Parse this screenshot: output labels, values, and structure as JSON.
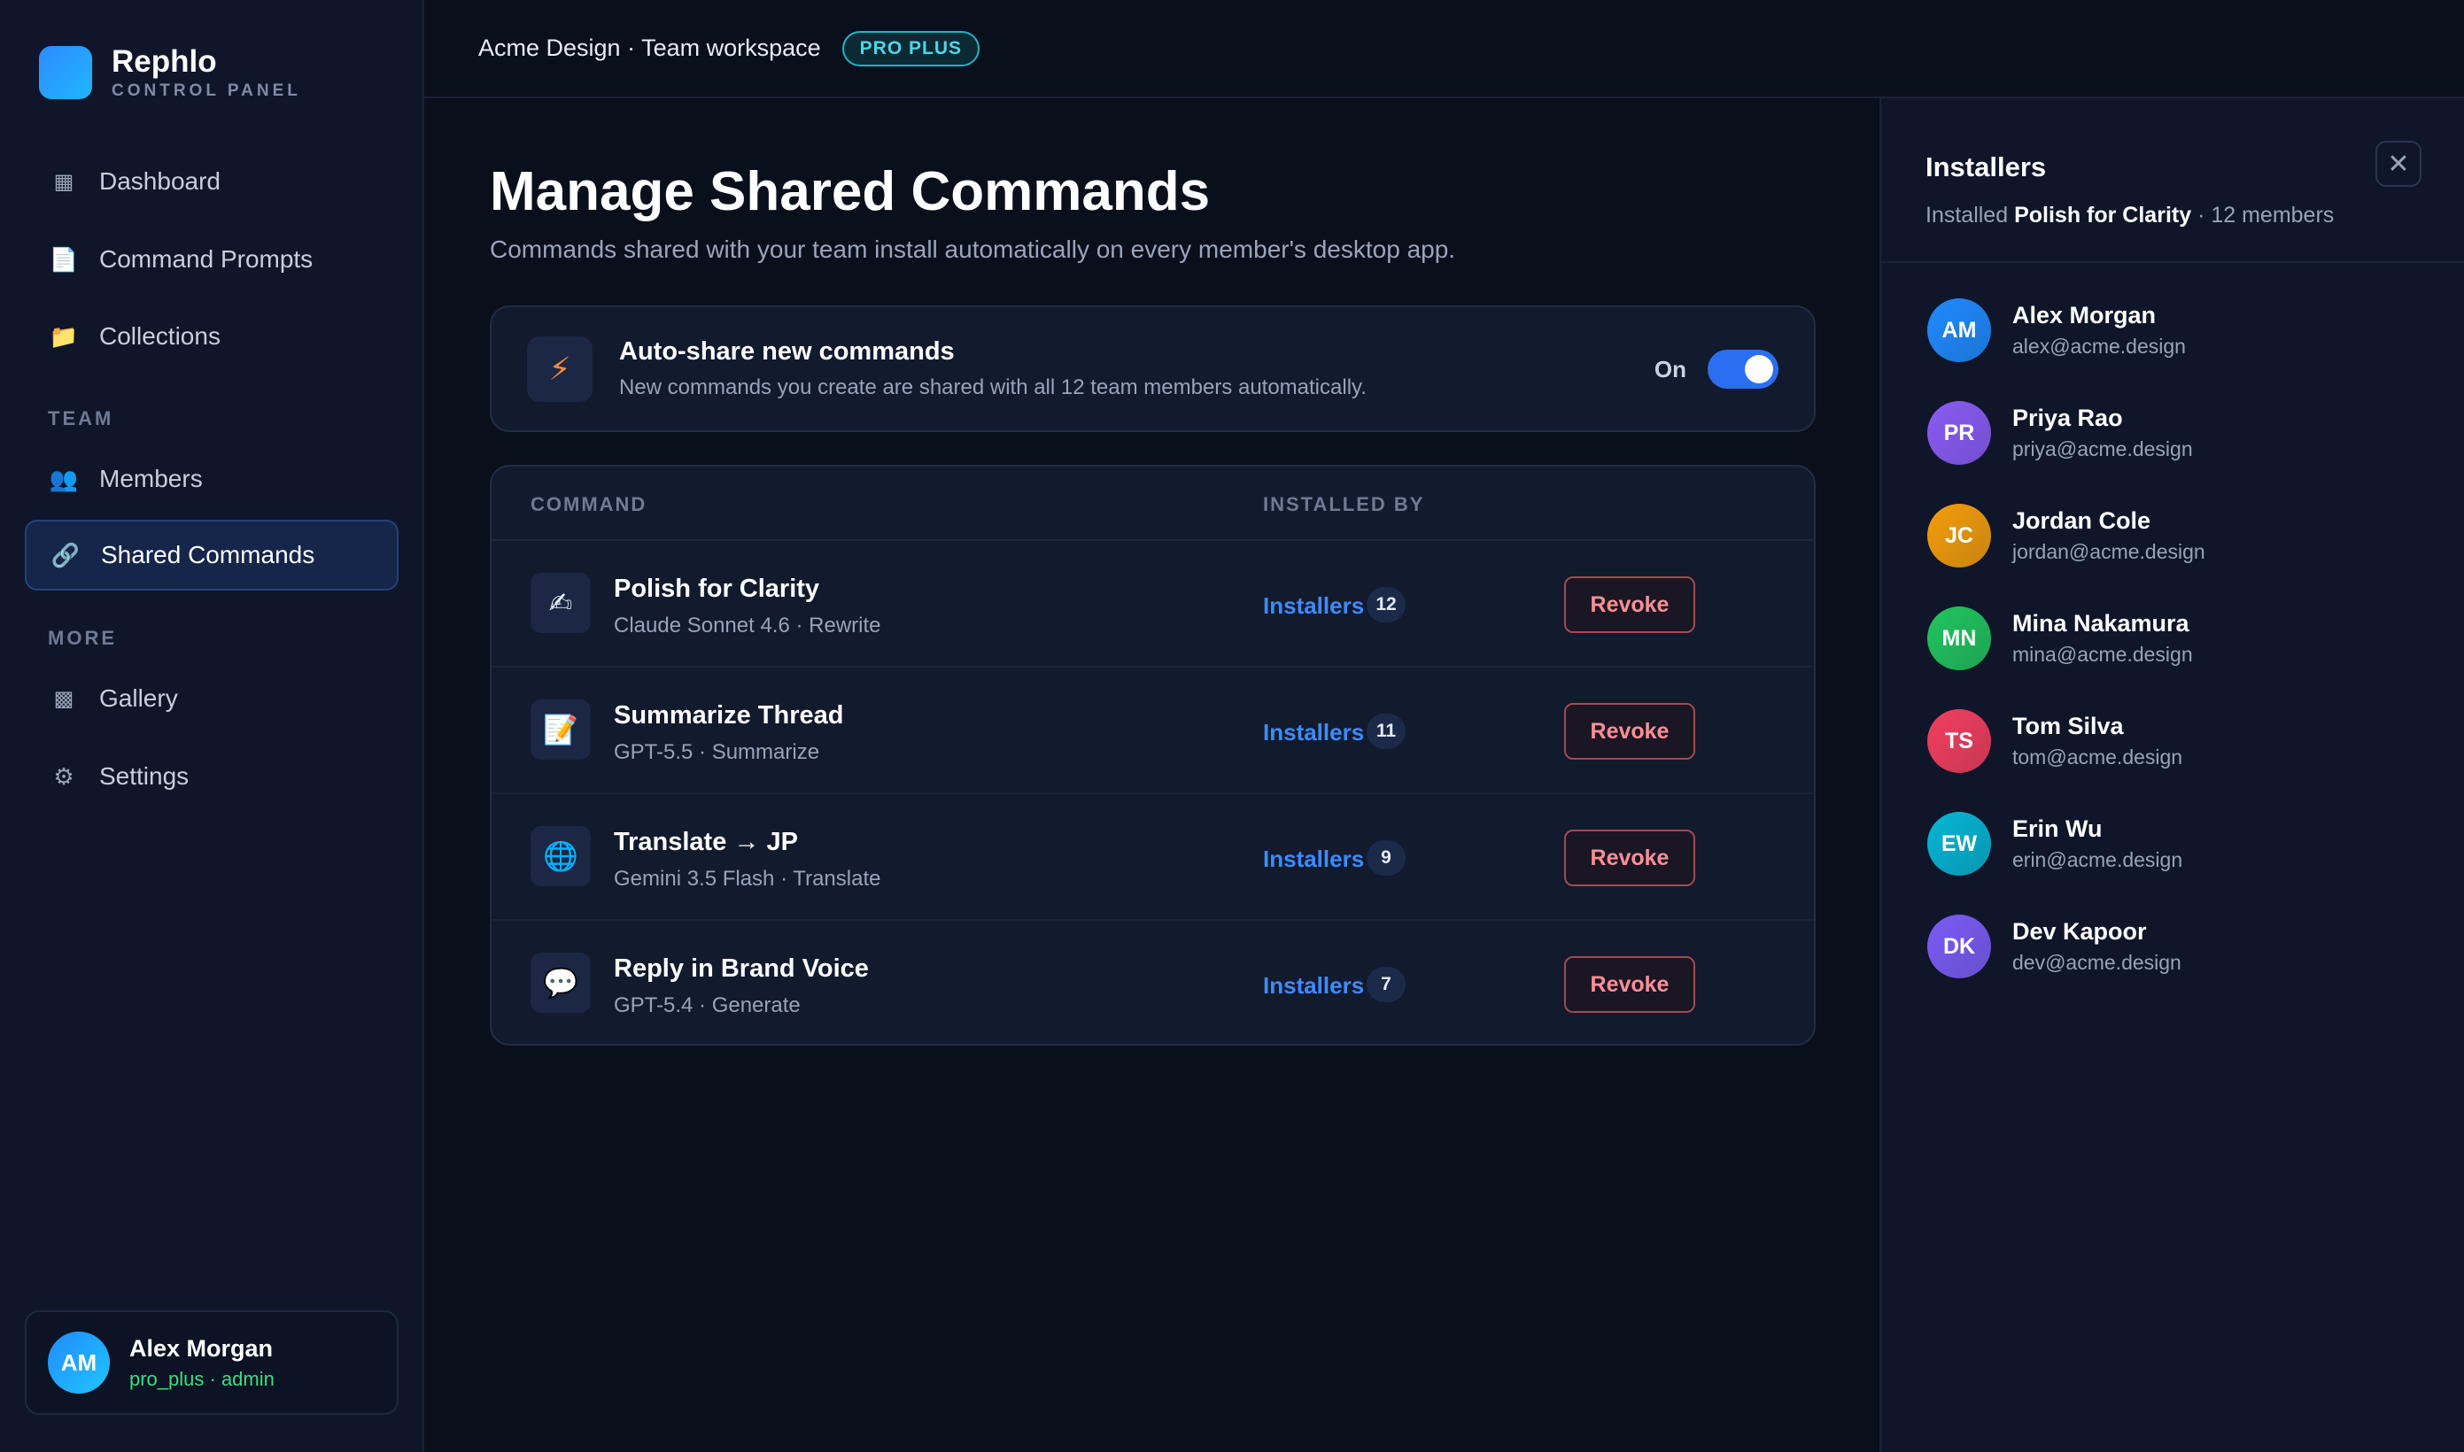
{
  "brand": {
    "name": "Rephlo",
    "subtitle": "CONTROL PANEL"
  },
  "sidebar": {
    "items": [
      {
        "label": "Dashboard",
        "icon": "▦"
      },
      {
        "label": "Command Prompts",
        "icon": "📄"
      },
      {
        "label": "Collections",
        "icon": "📁"
      }
    ],
    "team_section": "TEAM",
    "team_items": [
      {
        "label": "Members",
        "icon": "👥"
      },
      {
        "label": "Shared Commands",
        "icon": "🔗"
      }
    ],
    "more_section": "MORE",
    "more_items": [
      {
        "label": "Gallery",
        "icon": "▩"
      },
      {
        "label": "Settings",
        "icon": "⚙"
      }
    ],
    "user": {
      "initials": "AM",
      "name": "Alex Morgan",
      "role": "pro_plus · admin"
    }
  },
  "topbar": {
    "workspace": "Acme Design · Team workspace",
    "plan": "PRO PLUS"
  },
  "main": {
    "title": "Manage Shared Commands",
    "description": "Commands shared with your team install automatically on every member's desktop app.",
    "autoshare": {
      "title": "Auto-share new commands",
      "subtitle": "New commands you create are shared with all 12 team members automatically.",
      "state_label": "On",
      "enabled": true
    },
    "table": {
      "headers": [
        "COMMAND",
        "INSTALLED BY"
      ],
      "rows": [
        {
          "icon": "✍",
          "title": "Polish for Clarity",
          "sub": "Claude Sonnet 4.6 · Rewrite",
          "link": "Installers",
          "count": "12",
          "action": "Revoke"
        },
        {
          "icon": "📝",
          "title": "Summarize Thread",
          "sub": "GPT-5.5 · Summarize",
          "link": "Installers",
          "count": "11",
          "action": "Revoke"
        },
        {
          "icon": "🌐",
          "title": "Translate → JP",
          "sub": "Gemini 3.5 Flash · Translate",
          "link": "Installers",
          "count": "9",
          "action": "Revoke"
        },
        {
          "icon": "💬",
          "title": "Reply in Brand Voice",
          "sub": "GPT-5.4 · Generate",
          "link": "Installers",
          "count": "7",
          "action": "Revoke"
        }
      ]
    }
  },
  "panel": {
    "title": "Installers",
    "sub_prefix": "Installed",
    "sub_command": "Polish for Clarity",
    "sub_suffix": "· 12 members",
    "members": [
      {
        "initials": "AM",
        "name": "Alex Morgan",
        "email": "alex@acme.design",
        "color": "#1f8bff"
      },
      {
        "initials": "PR",
        "name": "Priya Rao",
        "email": "priya@acme.design",
        "color": "#8b5cf6"
      },
      {
        "initials": "JC",
        "name": "Jordan Cole",
        "email": "jordan@acme.design",
        "color": "#f59e0b"
      },
      {
        "initials": "MN",
        "name": "Mina Nakamura",
        "email": "mina@acme.design",
        "color": "#22c55e"
      },
      {
        "initials": "TS",
        "name": "Tom Silva",
        "email": "tom@acme.design",
        "color": "#f43f5e"
      },
      {
        "initials": "EW",
        "name": "Erin Wu",
        "email": "erin@acme.design",
        "color": "#06b6d4"
      },
      {
        "initials": "DK",
        "name": "Dev Kapoor",
        "email": "dev@acme.design",
        "color": "#7c5cf6"
      }
    ]
  }
}
